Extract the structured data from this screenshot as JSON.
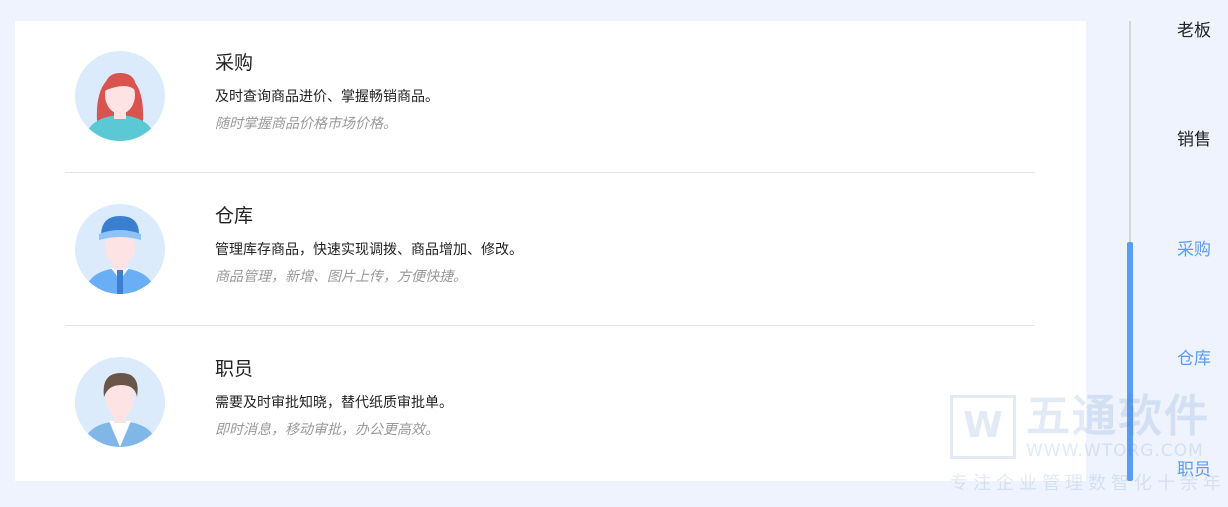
{
  "roles": [
    {
      "title": "采购",
      "desc": "及时查询商品进价、掌握畅销商品。",
      "sub": "随时掌握商品价格市场价格。",
      "icon": "female-user-avatar-icon"
    },
    {
      "title": "仓库",
      "desc": "管理库存商品，快速实现调拨、商品增加、修改。",
      "sub": "商品管理，新增、图片上传，方便快捷。",
      "icon": "warehouse-worker-avatar-icon"
    },
    {
      "title": "职员",
      "desc": "需要及时审批知晓，替代纸质审批单。",
      "sub": "即时消息，移动审批，办公更高效。",
      "icon": "male-staff-avatar-icon"
    }
  ],
  "nav": {
    "items": [
      "老板",
      "销售",
      "采购",
      "仓库",
      "职员"
    ],
    "active_color": "#5b9cf3",
    "inactive_color": "#222222"
  },
  "watermark": {
    "logo": "W",
    "name": "五通软件",
    "url": "WWW.WTORG.COM",
    "slogan": "专注企业管理数智化十余年"
  }
}
